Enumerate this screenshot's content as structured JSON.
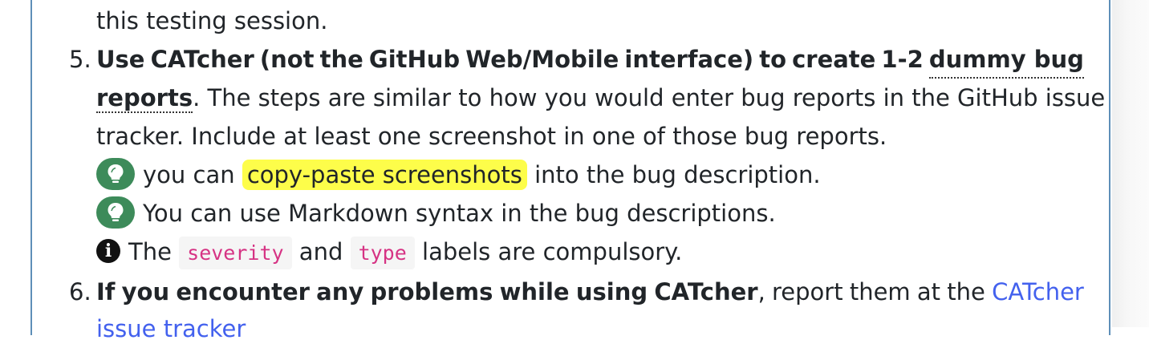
{
  "prev_line": "this testing session.",
  "item5": {
    "number": "5.",
    "w1": "Use",
    "w2": "CATcher",
    "w3": "(not",
    "w4": "the",
    "w5": "GitHub",
    "w6": "Web/Mobile",
    "w7": "interface)",
    "w8": "to",
    "w9": "create",
    "w10": "1-2",
    "w11": "dummy bug",
    "line2_bold": "reports",
    "line2_rest": ". The steps are similar to how you would enter bug reports in the GitHub issue",
    "line3": "tracker. Include at least one screenshot in one of those bug reports.",
    "tip1_pre": "you can",
    "tip1_highlight": "copy-paste screenshots",
    "tip1_post": "into the bug description.",
    "tip2": "You can use Markdown syntax in the bug descriptions.",
    "info_pre": "The",
    "code1": "severity",
    "info_mid": "and",
    "code2": "type",
    "info_post": "labels are compulsory."
  },
  "item6": {
    "number": "6.",
    "b1": "If",
    "b2": "you",
    "b3": "encounter",
    "b4": "any",
    "b5": "problems",
    "b6": "while",
    "b7": "using",
    "b8": "CATcher",
    "r1": ",",
    "r2": "report",
    "r3": "them",
    "r4": "at",
    "r5": "the",
    "link": "CATcher",
    "line2_link": "issue tracker"
  },
  "icons": {
    "tip": "lightbulb-icon",
    "info": "info-icon"
  },
  "colors": {
    "tip_bg": "#3d8b5a",
    "highlight": "#fdfd4a",
    "code_text": "#d63384",
    "link": "#4361ee",
    "border": "#5e8fb8"
  }
}
